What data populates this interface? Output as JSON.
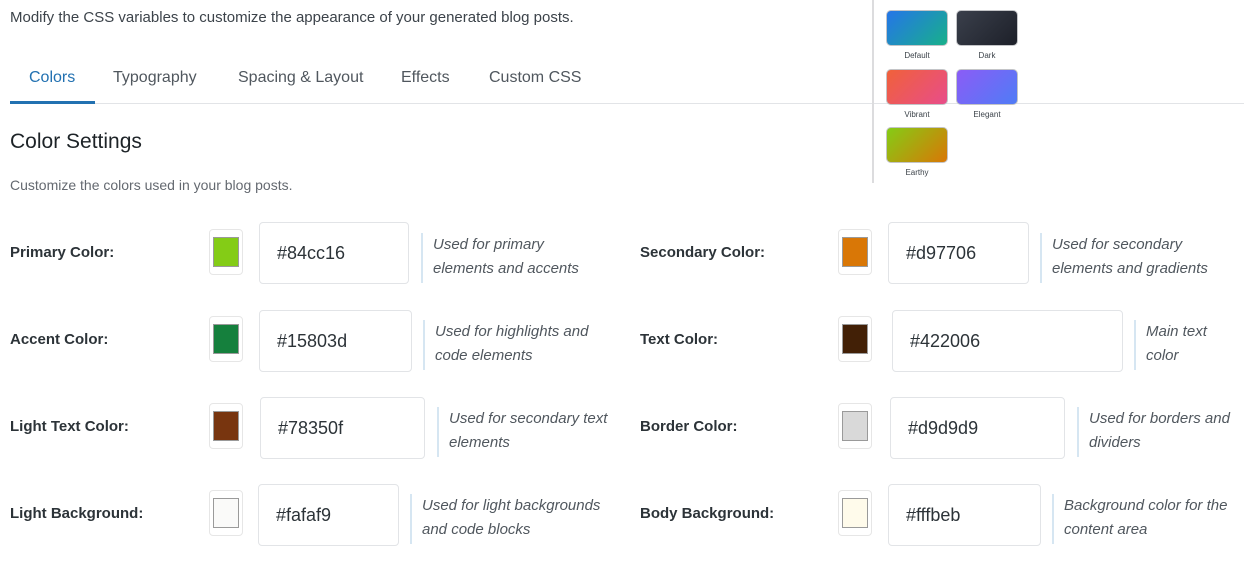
{
  "intro": "Modify the CSS variables to customize the appearance of your generated blog posts.",
  "tabs": [
    {
      "label": "Colors",
      "active": true
    },
    {
      "label": "Typography"
    },
    {
      "label": "Spacing & Layout"
    },
    {
      "label": "Effects"
    },
    {
      "label": "Custom CSS"
    }
  ],
  "presets": [
    {
      "label": "Default",
      "from": "#2575e8",
      "to": "#18b08a"
    },
    {
      "label": "Dark",
      "from": "#3a3f4b",
      "to": "#1d2029"
    },
    {
      "label": "Vibrant",
      "from": "#f0613a",
      "to": "#e84d8a"
    },
    {
      "label": "Elegant",
      "from": "#8b5cf6",
      "to": "#4f7cf6"
    },
    {
      "label": "Earthy",
      "from": "#84cc16",
      "to": "#d97706"
    }
  ],
  "section": {
    "title": "Color Settings",
    "description": "Customize the colors used in your blog posts."
  },
  "colors": [
    {
      "label": "Primary Color:",
      "value": "#84cc16",
      "help": [
        "Used for primary",
        "elements and accents"
      ]
    },
    {
      "label": "Secondary Color:",
      "value": "#d97706",
      "help": [
        "Used for secondary",
        "elements and gradients"
      ]
    },
    {
      "label": "Accent Color:",
      "value": "#15803d",
      "help": [
        "Used for highlights and",
        "code elements"
      ]
    },
    {
      "label": "Text Color:",
      "value": "#422006",
      "help": [
        "Main text",
        "color"
      ]
    },
    {
      "label": "Light Text Color:",
      "value": "#78350f",
      "help": [
        "Used for secondary text",
        "elements"
      ]
    },
    {
      "label": "Border Color:",
      "value": "#d9d9d9",
      "help": [
        "Used for borders and",
        "dividers"
      ]
    },
    {
      "label": "Light Background:",
      "value": "#fafaf9",
      "help": [
        "Used for light backgrounds",
        "and code blocks"
      ]
    },
    {
      "label": "Body Background:",
      "value": "#fffbeb",
      "help": [
        "Background color for the",
        "content area"
      ]
    }
  ]
}
